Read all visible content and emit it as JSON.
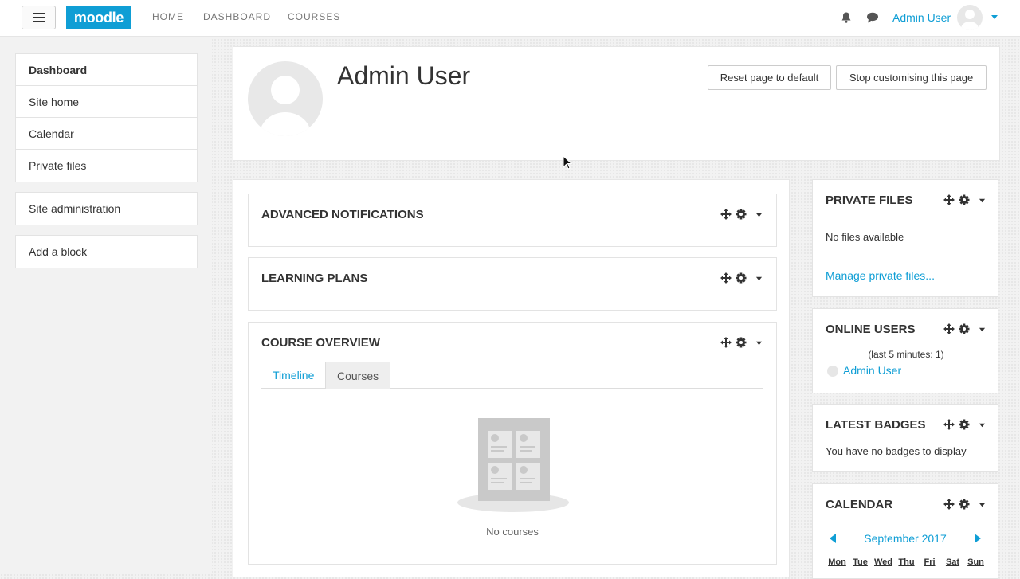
{
  "navbar": {
    "brand": "moodle",
    "links": [
      "HOME",
      "DASHBOARD",
      "COURSES"
    ],
    "user_name": "Admin User",
    "accent": "#0f9ed5"
  },
  "drawer": {
    "group1": [
      "Dashboard",
      "Site home",
      "Calendar",
      "Private files"
    ],
    "group2": [
      "Site administration"
    ],
    "group3": [
      "Add a block"
    ]
  },
  "header": {
    "title": "Admin User",
    "reset_label": "Reset page to default",
    "stop_label": "Stop customising this page"
  },
  "main_blocks": {
    "advanced_notifications": "ADVANCED NOTIFICATIONS",
    "learning_plans": "LEARNING PLANS",
    "course_overview": {
      "title": "COURSE OVERVIEW",
      "tabs": [
        "Timeline",
        "Courses"
      ],
      "empty_text": "No courses"
    }
  },
  "side_blocks": {
    "private_files": {
      "title": "PRIVATE FILES",
      "empty_text": "No files available",
      "manage_link": "Manage private files..."
    },
    "online_users": {
      "title": "ONLINE USERS",
      "summary": "(last 5 minutes: 1)",
      "user": "Admin User"
    },
    "latest_badges": {
      "title": "LATEST BADGES",
      "empty_text": "You have no badges to display"
    },
    "calendar": {
      "title": "CALENDAR",
      "month": "September 2017",
      "days": [
        "Mon",
        "Tue",
        "Wed",
        "Thu",
        "Fri",
        "Sat",
        "Sun"
      ]
    }
  }
}
